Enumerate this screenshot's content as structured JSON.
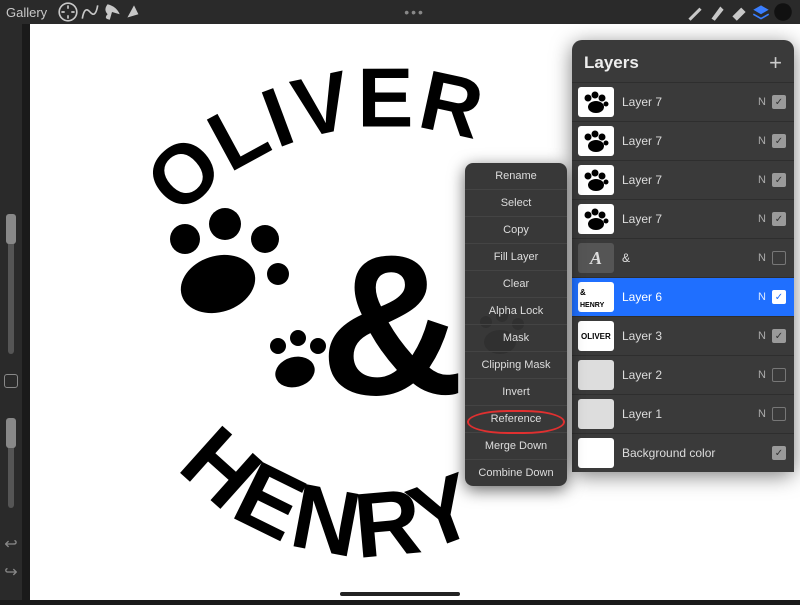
{
  "toolbar": {
    "gallery": "Gallery",
    "center_dots": "•••"
  },
  "canvas_art": {
    "line_top": "OLIVER",
    "line_mid": "&",
    "line_bottom": "HENRY"
  },
  "layers_panel": {
    "title": "Layers",
    "items": [
      {
        "name": "Layer 7",
        "blend": "N",
        "visible": true,
        "thumb": "paw"
      },
      {
        "name": "Layer 7",
        "blend": "N",
        "visible": true,
        "thumb": "paw"
      },
      {
        "name": "Layer 7",
        "blend": "N",
        "visible": true,
        "thumb": "paw"
      },
      {
        "name": "Layer 7",
        "blend": "N",
        "visible": true,
        "thumb": "paw"
      },
      {
        "name": "&",
        "blend": "N",
        "visible": false,
        "thumb": "text"
      },
      {
        "name": "Layer 6",
        "blend": "N",
        "visible": true,
        "thumb": "art",
        "selected": true
      },
      {
        "name": "Layer 3",
        "blend": "N",
        "visible": true,
        "thumb": "oliver"
      },
      {
        "name": "Layer 2",
        "blend": "N",
        "visible": false,
        "thumb": "blank"
      },
      {
        "name": "Layer 1",
        "blend": "N",
        "visible": false,
        "thumb": "blank"
      },
      {
        "name": "Background color",
        "blend": "",
        "visible": true,
        "thumb": "bg"
      }
    ]
  },
  "context_menu": {
    "items": [
      "Rename",
      "Select",
      "Copy",
      "Fill Layer",
      "Clear",
      "Alpha Lock",
      "Mask",
      "Clipping Mask",
      "Invert",
      "Reference",
      "Merge Down",
      "Combine Down"
    ],
    "highlighted": "Merge Down"
  },
  "colors": {
    "selection": "#1f6fff",
    "annotation": "#e03030"
  }
}
